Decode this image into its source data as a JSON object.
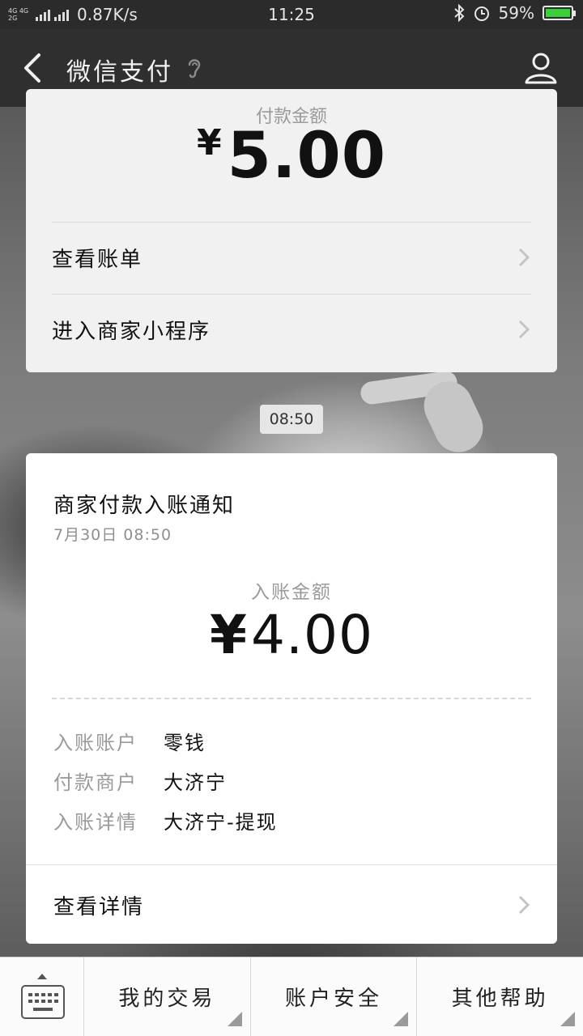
{
  "status_bar": {
    "network_label": "4G 4G\n2G",
    "speed": "0.87K/s",
    "time": "11:25",
    "battery": "59%",
    "battery_color": "#3ccf3c"
  },
  "nav": {
    "title": "微信支付",
    "back_icon": "chevron-left-icon",
    "ear_icon": "ear-icon",
    "user_icon": "user-icon"
  },
  "top_card": {
    "label": "付款金额",
    "currency": "¥",
    "amount": "5.00",
    "links": [
      {
        "label": "查看账单"
      },
      {
        "label": "进入商家小程序"
      }
    ]
  },
  "time_divider": "08:50",
  "notice_card": {
    "title": "商家付款入账通知",
    "date": "7月30日  08:50",
    "amount_label": "入账金额",
    "currency": "¥",
    "amount": "4.00",
    "details": [
      {
        "key": "入账账户",
        "value": "零钱"
      },
      {
        "key": "付款商户",
        "value": "大济宁"
      },
      {
        "key": "入账详情",
        "value": "大济宁-提现"
      }
    ],
    "view_details": "查看详情"
  },
  "bottom_menu": {
    "keyboard_icon": "keyboard-icon",
    "items": [
      {
        "label": "我的交易"
      },
      {
        "label": "账户安全"
      },
      {
        "label": "其他帮助"
      }
    ]
  }
}
